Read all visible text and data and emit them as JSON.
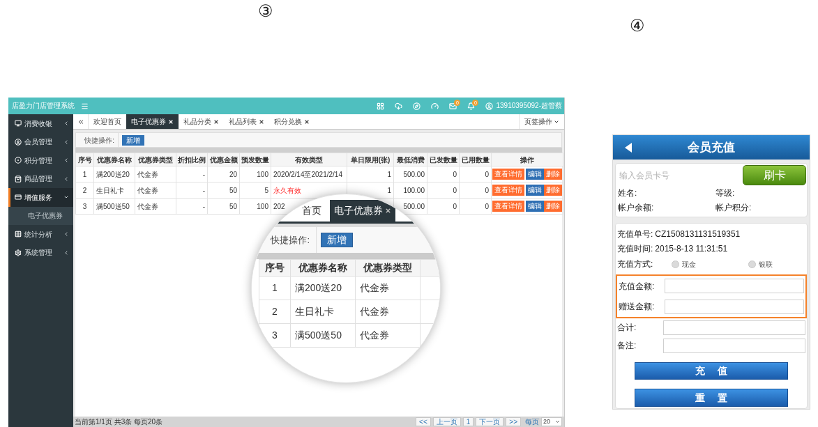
{
  "step_markers": [
    {
      "text": "③"
    },
    {
      "text": "④"
    }
  ],
  "admin": {
    "app_title": "店盈力门店管理系统",
    "mail_badge": "0",
    "bell_badge": "0",
    "user": "13910395092-超管蔡",
    "sidebar": [
      {
        "label": "消费收银",
        "selected": false,
        "expanded": false
      },
      {
        "label": "会员管理",
        "selected": false,
        "expanded": false
      },
      {
        "label": "积分管理",
        "selected": false,
        "expanded": false
      },
      {
        "label": "商品管理",
        "selected": false,
        "expanded": false
      },
      {
        "label": "增值服务",
        "selected": true,
        "expanded": true,
        "children": [
          {
            "label": "电子优惠券",
            "selected": false
          }
        ]
      },
      {
        "label": "统计分析",
        "selected": false,
        "expanded": false
      },
      {
        "label": "系统管理",
        "selected": false,
        "expanded": false
      }
    ],
    "tabs": [
      {
        "label": "欢迎首页",
        "selected": false,
        "closable": false
      },
      {
        "label": "电子优惠券",
        "selected": true,
        "closable": true
      },
      {
        "label": "礼品分类",
        "selected": false,
        "closable": true
      },
      {
        "label": "礼品列表",
        "selected": false,
        "closable": true
      },
      {
        "label": "积分兑换",
        "selected": false,
        "closable": true
      }
    ],
    "tab_menu": "页签操作",
    "quick_actions": {
      "label": "快捷操作:",
      "button": "新增"
    },
    "table": {
      "columns": [
        "序号",
        "优惠券名称",
        "优惠券类型",
        "折扣比例",
        "优惠金额",
        "预发数量",
        "有效类型",
        "单日限用(张)",
        "最低消费",
        "已发数量",
        "已用数量",
        "操作"
      ],
      "rows": [
        {
          "no": "1",
          "name": "满200送20",
          "type": "代金券",
          "discount": "-",
          "amount": "20",
          "quantity": "100",
          "validity": "2020/2/14至2021/2/14",
          "validity_highlighted": false,
          "daily_limit": "1",
          "min_spend": "500.00",
          "issued": "0",
          "used": "0",
          "actions": [
            {
              "kind": "view",
              "label": "查看详情"
            },
            {
              "kind": "edit",
              "label": "编辑"
            },
            {
              "kind": "delete",
              "label": "删除"
            }
          ]
        },
        {
          "no": "2",
          "name": "生日礼卡",
          "type": "代金券",
          "discount": "-",
          "amount": "50",
          "quantity": "5",
          "validity": "永久有效",
          "validity_highlighted": true,
          "daily_limit": "1",
          "min_spend": "100.00",
          "issued": "0",
          "used": "0",
          "actions": [
            {
              "kind": "view",
              "label": "查看详情"
            },
            {
              "kind": "edit",
              "label": "编辑"
            },
            {
              "kind": "delete",
              "label": "删除"
            }
          ]
        },
        {
          "no": "3",
          "name": "满500送50",
          "type": "代金券",
          "discount": "-",
          "amount": "50",
          "quantity": "100",
          "validity": "202",
          "validity_highlighted": false,
          "min_spend": "500.00",
          "issued": "0",
          "used": "0",
          "actions": [
            {
              "kind": "view",
              "label": "查看详情"
            },
            {
              "kind": "edit",
              "label": "编辑"
            },
            {
              "kind": "delete",
              "label": "删除"
            }
          ]
        }
      ]
    },
    "status_bar": {
      "summary": "当前第1/1页 共3条 每页20条",
      "pager": [
        "<<",
        "上一页",
        "1",
        "下一页",
        ">>"
      ],
      "page_size_label": "每页",
      "page_size": "20"
    }
  },
  "magnifier": {
    "tabs": [
      {
        "label": "首页",
        "selected": false,
        "closable": false
      },
      {
        "label": "电子优惠券",
        "selected": true,
        "closable": true
      }
    ],
    "quick_actions": {
      "label": "快捷操作:",
      "button": "新增"
    },
    "columns": [
      "序号",
      "优惠券名称",
      "优惠券类型"
    ],
    "rows": [
      {
        "no": "1",
        "name": "满200送20",
        "type": "代金券"
      },
      {
        "no": "2",
        "name": "生日礼卡",
        "type": "代金券"
      },
      {
        "no": "3",
        "name": "满500送50",
        "type": "代金券"
      }
    ]
  },
  "phone": {
    "title": "会员充值",
    "card_number": {
      "placeholder": "输入会员卡号"
    },
    "swipe_button": "刷卡",
    "member_info": [
      "姓名:",
      "等级:",
      "帐户余额:",
      "帐户积分:"
    ],
    "order_no": {
      "label": "充值单号:",
      "value": "CZ1508131131519351"
    },
    "time": {
      "label": "充值时间:",
      "value": "2015-8-13 11:31:51"
    },
    "payment": {
      "label": "充值方式:",
      "options": [
        {
          "label": "现金",
          "selected": false
        },
        {
          "label": "银联",
          "selected": false
        }
      ]
    },
    "fields": [
      {
        "label": "充值金额:",
        "highlighted": true
      },
      {
        "label": "赠送金额:",
        "highlighted": true
      },
      {
        "label": "合计:",
        "highlighted": false
      },
      {
        "label": "备注:",
        "highlighted": false
      }
    ],
    "buttons": [
      "充 值",
      "重 置"
    ]
  }
}
